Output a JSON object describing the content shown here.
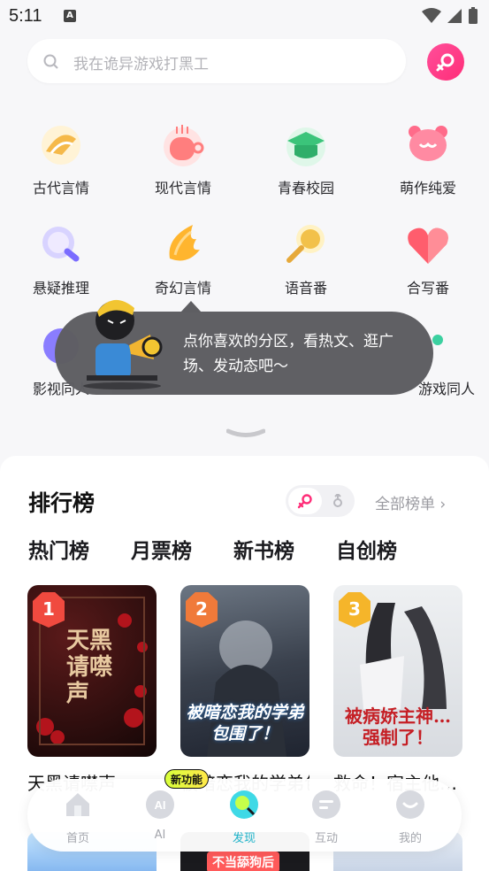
{
  "status_bar": {
    "time": "5:11",
    "notif_icon": "A"
  },
  "search": {
    "placeholder": "我在诡异游戏打黑工"
  },
  "categories": [
    {
      "label": "古代言情",
      "icon": "fan-icon",
      "color": "#f5b94a"
    },
    {
      "label": "现代言情",
      "icon": "teacup-icon",
      "color": "#ff7e7e"
    },
    {
      "label": "青春校园",
      "icon": "grad-cap-icon",
      "color": "#3bc47a"
    },
    {
      "label": "萌作纯爱",
      "icon": "cute-face-icon",
      "color": "#ff6b8a"
    },
    {
      "label": "悬疑推理",
      "icon": "magnifier-icon",
      "color": "#8a7dff"
    },
    {
      "label": "奇幻言情",
      "icon": "wing-icon",
      "color": "#ffb52e"
    },
    {
      "label": "语音番",
      "icon": "microphone-icon",
      "color": "#f2c14a"
    },
    {
      "label": "合写番",
      "icon": "heart-icon",
      "color": "#ff5d6d"
    },
    {
      "label": "影视同人",
      "icon": "film-icon",
      "color": "#8a7dff"
    },
    {
      "label": "游戏同人",
      "icon": "game-icon",
      "color": "#3bd0a0"
    }
  ],
  "tooltip": {
    "text": "点你喜欢的分区，看热文、逛广场、发动态吧～"
  },
  "ranking": {
    "title": "排行榜",
    "all_label": "全部榜单 ›",
    "tabs": [
      "热门榜",
      "月票榜",
      "新书榜",
      "自创榜"
    ],
    "books": [
      {
        "rank": "1",
        "title": "天黑请噤声",
        "cover_text": "天黑请噤声",
        "badge_color": "#f04a3f"
      },
      {
        "rank": "2",
        "title": "被暗恋我的学弟包围了",
        "cover_text": "被暗恋我的学弟包围了！",
        "badge_color": "#f07a3a"
      },
      {
        "rank": "3",
        "title": "救命！宿主他…",
        "cover_text": "被病娇主神…强制了！",
        "badge_color": "#f5b52a"
      }
    ]
  },
  "tabbar": {
    "new_feature_badge": "新功能",
    "items": [
      {
        "label": "首页",
        "icon": "home-icon"
      },
      {
        "label": "AI",
        "icon": "ai-icon"
      },
      {
        "label": "发现",
        "icon": "discover-icon",
        "active": true
      },
      {
        "label": "互动",
        "icon": "chat-icon"
      },
      {
        "label": "我的",
        "icon": "profile-icon"
      }
    ]
  },
  "peek": {
    "caption": "不当舔狗后"
  },
  "colors": {
    "accent": "#3fd9e6",
    "pink": "#ff2d78",
    "tooltip_bg": "#5e5e62"
  }
}
